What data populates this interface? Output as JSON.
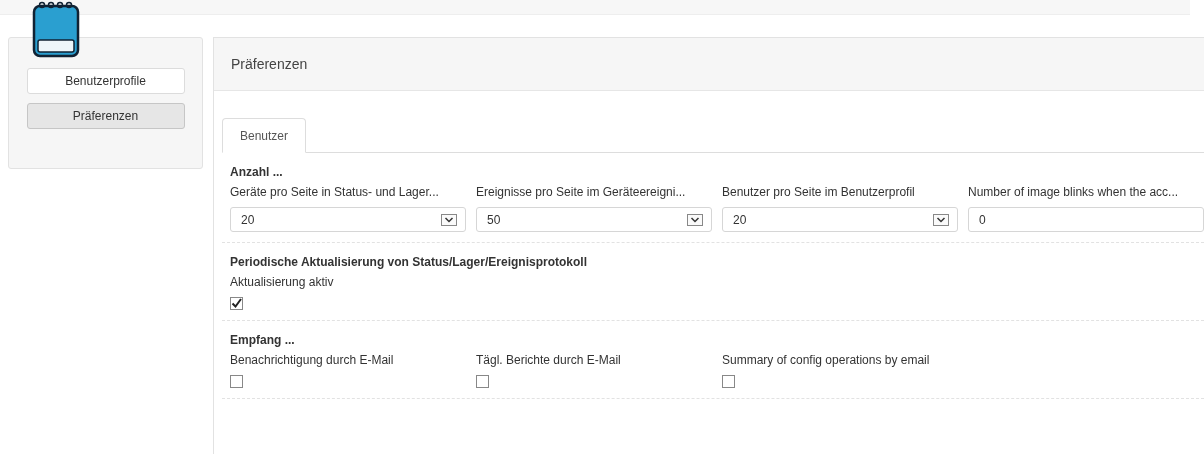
{
  "sidebar": {
    "items": [
      {
        "label": "Benutzerprofile",
        "selected": false
      },
      {
        "label": "Präferenzen",
        "selected": true
      }
    ]
  },
  "panel": {
    "title": "Präferenzen"
  },
  "tabs": [
    {
      "label": "Benutzer",
      "selected": true
    }
  ],
  "sections": [
    {
      "title": "Anzahl ...",
      "fields": [
        {
          "kind": "select",
          "label": "Geräte pro Seite in Status- und Lager...",
          "value": "20"
        },
        {
          "kind": "select",
          "label": "Ereignisse pro Seite im Geräteereigni...",
          "value": "50"
        },
        {
          "kind": "select",
          "label": "Benutzer pro Seite im Benutzerprofil",
          "value": "20"
        },
        {
          "kind": "input",
          "label": "Number of image blinks when the acc...",
          "value": "0"
        }
      ]
    },
    {
      "title": "Periodische Aktualisierung von Status/Lager/Ereignisprotokoll",
      "fields": [
        {
          "kind": "checkbox",
          "label": "Aktualisierung aktiv",
          "checked": true
        }
      ]
    },
    {
      "title": "Empfang ...",
      "fields": [
        {
          "kind": "checkbox",
          "label": "Benachrichtigung durch E-Mail",
          "checked": false
        },
        {
          "kind": "checkbox",
          "label": "Tägl. Berichte durch E-Mail",
          "checked": false
        },
        {
          "kind": "checkbox",
          "label": "Summary of config operations by email",
          "checked": false
        }
      ]
    }
  ]
}
